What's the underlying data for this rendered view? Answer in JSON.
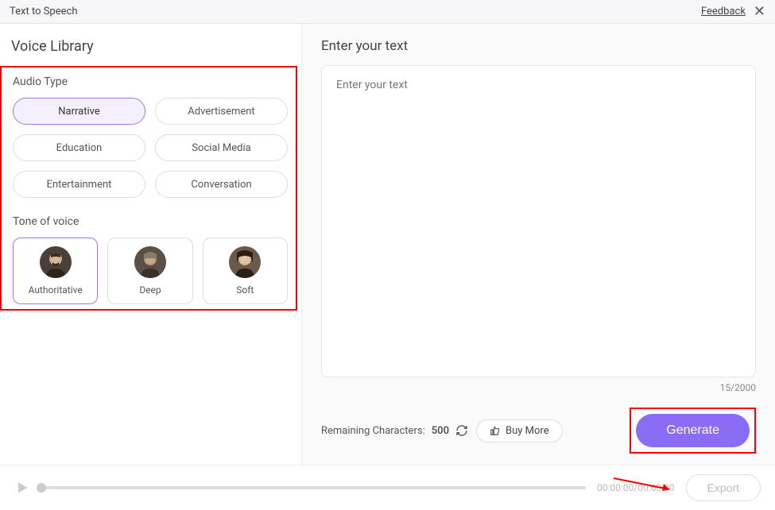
{
  "header": {
    "title": "Text to Speech",
    "feedback": "Feedback"
  },
  "voice_library": {
    "title": "Voice Library",
    "audio_type_label": "Audio Type",
    "audio_types": [
      {
        "label": "Narrative",
        "selected": true
      },
      {
        "label": "Advertisement",
        "selected": false
      },
      {
        "label": "Education",
        "selected": false
      },
      {
        "label": "Social Media",
        "selected": false
      },
      {
        "label": "Entertainment",
        "selected": false
      },
      {
        "label": "Conversation",
        "selected": false
      }
    ],
    "tone_label": "Tone of voice",
    "tones": [
      {
        "label": "Authoritative",
        "selected": true
      },
      {
        "label": "Deep",
        "selected": false
      },
      {
        "label": "Soft",
        "selected": false
      }
    ]
  },
  "editor": {
    "title": "Enter your text",
    "placeholder": "Enter your text",
    "count": "15/2000",
    "remaining_label": "Remaining Characters:",
    "remaining_value": "500",
    "buy_more": "Buy More",
    "generate": "Generate"
  },
  "player": {
    "time": "00:00:00/00:00:00",
    "export": "Export"
  }
}
